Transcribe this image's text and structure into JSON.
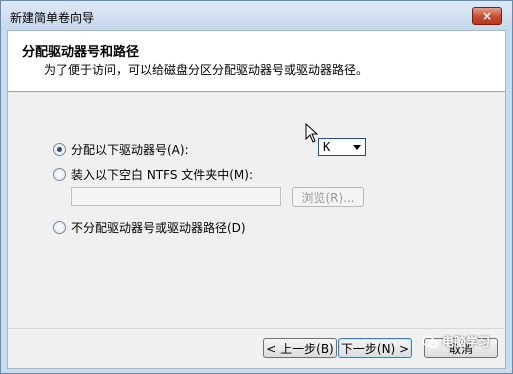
{
  "window": {
    "title": "新建简单卷向导",
    "close_label": "×"
  },
  "header": {
    "title": "分配驱动器号和路径",
    "subtitle": "为了便于访问，可以给磁盘分区分配驱动器号或驱动器路径。"
  },
  "options": {
    "assign_letter_label": "分配以下驱动器号(A):",
    "mount_folder_label": "装入以下空白 NTFS 文件夹中(M):",
    "no_assign_label": "不分配驱动器号或驱动器路径(D)"
  },
  "drive_letter": {
    "value": "K"
  },
  "folder_path": {
    "value": ""
  },
  "browse": {
    "label": "浏览(R)..."
  },
  "footer": {
    "back_label": "< 上一步(B)",
    "next_label": "下一步(N) >",
    "cancel_label": "取消"
  },
  "watermark": {
    "text": "电脑学习"
  }
}
